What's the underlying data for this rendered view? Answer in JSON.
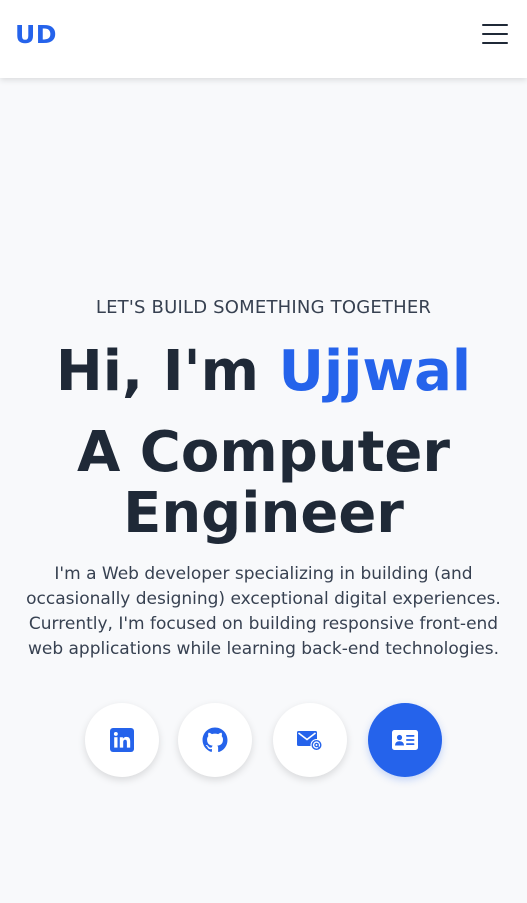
{
  "navbar": {
    "logo": "UD",
    "menu_icon": "hamburger-menu-icon"
  },
  "hero": {
    "eyebrow": "LET'S BUILD SOMETHING TOGETHER",
    "greeting_prefix": "Hi, I'm ",
    "greeting_name": "Ujjwal",
    "role_line1": "A Computer",
    "role_line2": "Engineer",
    "description": "I'm a Web developer specializing in building (and occasionally designing) exceptional digital experiences. Currently, I'm focused on building responsive front-end web applications while learning back-end technologies."
  },
  "socials": [
    {
      "icon": "linkedin-icon"
    },
    {
      "icon": "github-icon"
    },
    {
      "icon": "email-icon"
    },
    {
      "icon": "contact-card-icon"
    }
  ],
  "colors": {
    "accent": "#2563eb",
    "text_dark": "#1f2937",
    "background": "#f8f9fb"
  }
}
